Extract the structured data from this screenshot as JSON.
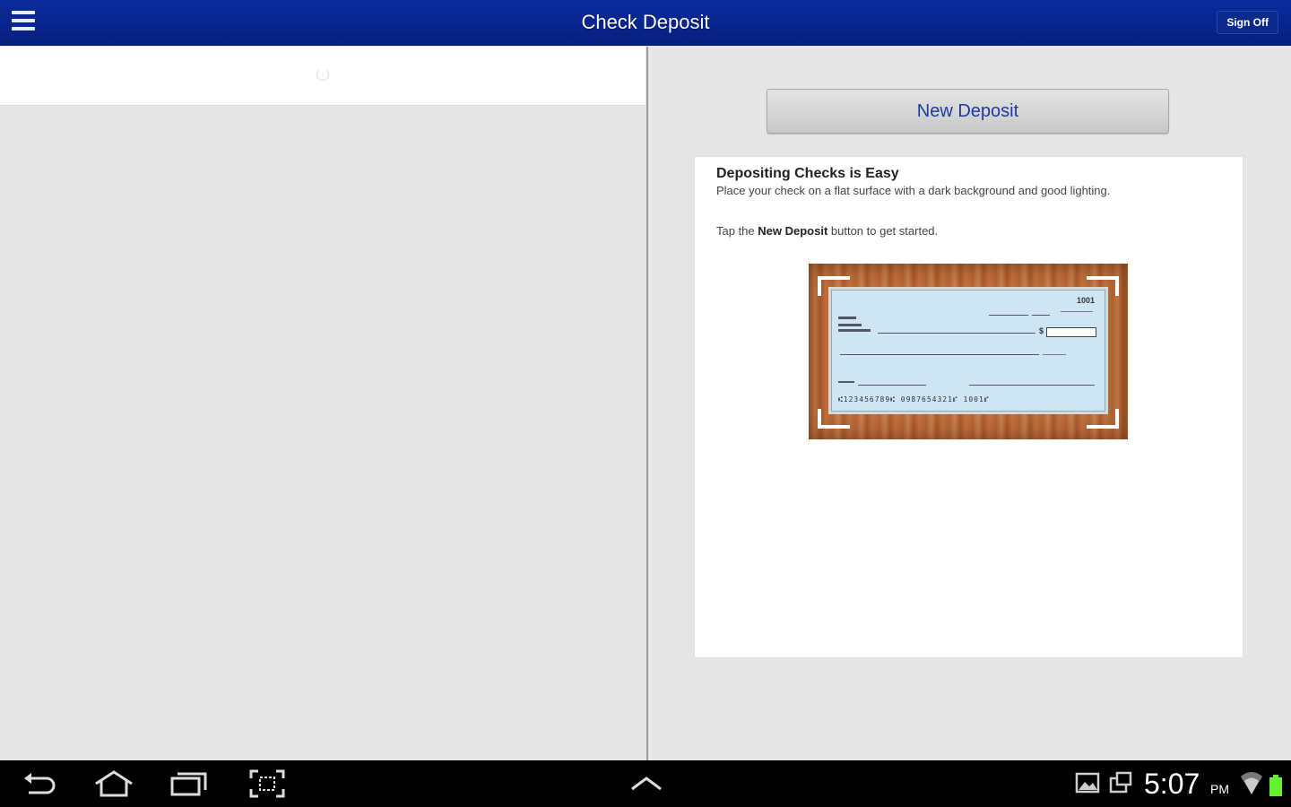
{
  "header": {
    "title": "Check Deposit",
    "signoff_label": "Sign Off"
  },
  "main": {
    "new_deposit_label": "New Deposit",
    "card": {
      "title": "Depositing Checks is Easy",
      "description": "Place your check on a flat surface with a dark background and good lighting.",
      "tap_prefix": "Tap the ",
      "tap_bold": "New Deposit",
      "tap_suffix": " button to get started."
    },
    "check_image": {
      "check_number": "1001",
      "micr_line": "⑆123456789⑆  0987654321⑈  1001⑈"
    }
  },
  "system_bar": {
    "time": "5:07",
    "ampm": "PM",
    "icons": [
      "back-icon",
      "home-icon",
      "recent-apps-icon",
      "screenshot-icon",
      "up-arrow-icon",
      "gallery-icon",
      "notification-icon",
      "wifi-icon",
      "battery-icon"
    ]
  },
  "colors": {
    "header_blue": "#061f80",
    "button_text": "#1e3a9a",
    "battery_green": "#66ee33"
  }
}
